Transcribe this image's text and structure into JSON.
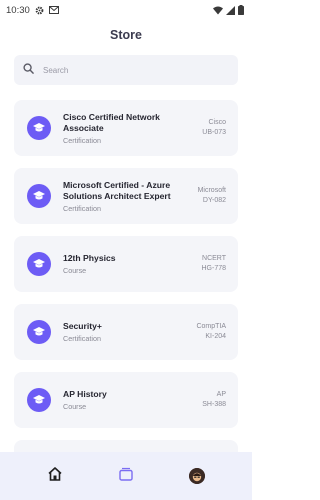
{
  "status_bar": {
    "time": "10:30"
  },
  "header": {
    "title": "Store"
  },
  "search": {
    "placeholder": "Search"
  },
  "items": [
    {
      "title": "Cisco Certified Network Associate",
      "type": "Certification",
      "provider": "Cisco",
      "code": "UB-073"
    },
    {
      "title": "Microsoft Certified - Azure Solutions Architect Expert",
      "type": "Certification",
      "provider": "Microsoft",
      "code": "DY-082"
    },
    {
      "title": "12th Physics",
      "type": "Course",
      "provider": "NCERT",
      "code": "HG-778"
    },
    {
      "title": "Security+",
      "type": "Certification",
      "provider": "CompTIA",
      "code": "KI-204"
    },
    {
      "title": "AP History",
      "type": "Course",
      "provider": "AP",
      "code": "SH-388"
    }
  ],
  "bottom_nav": [
    {
      "icon": "home-icon"
    },
    {
      "icon": "store-icon",
      "active": true
    },
    {
      "icon": "profile-avatar"
    }
  ],
  "colors": {
    "accent": "#6d5cf5",
    "card_bg": "#f4f5f9",
    "nav_bg": "#eef0fb"
  }
}
